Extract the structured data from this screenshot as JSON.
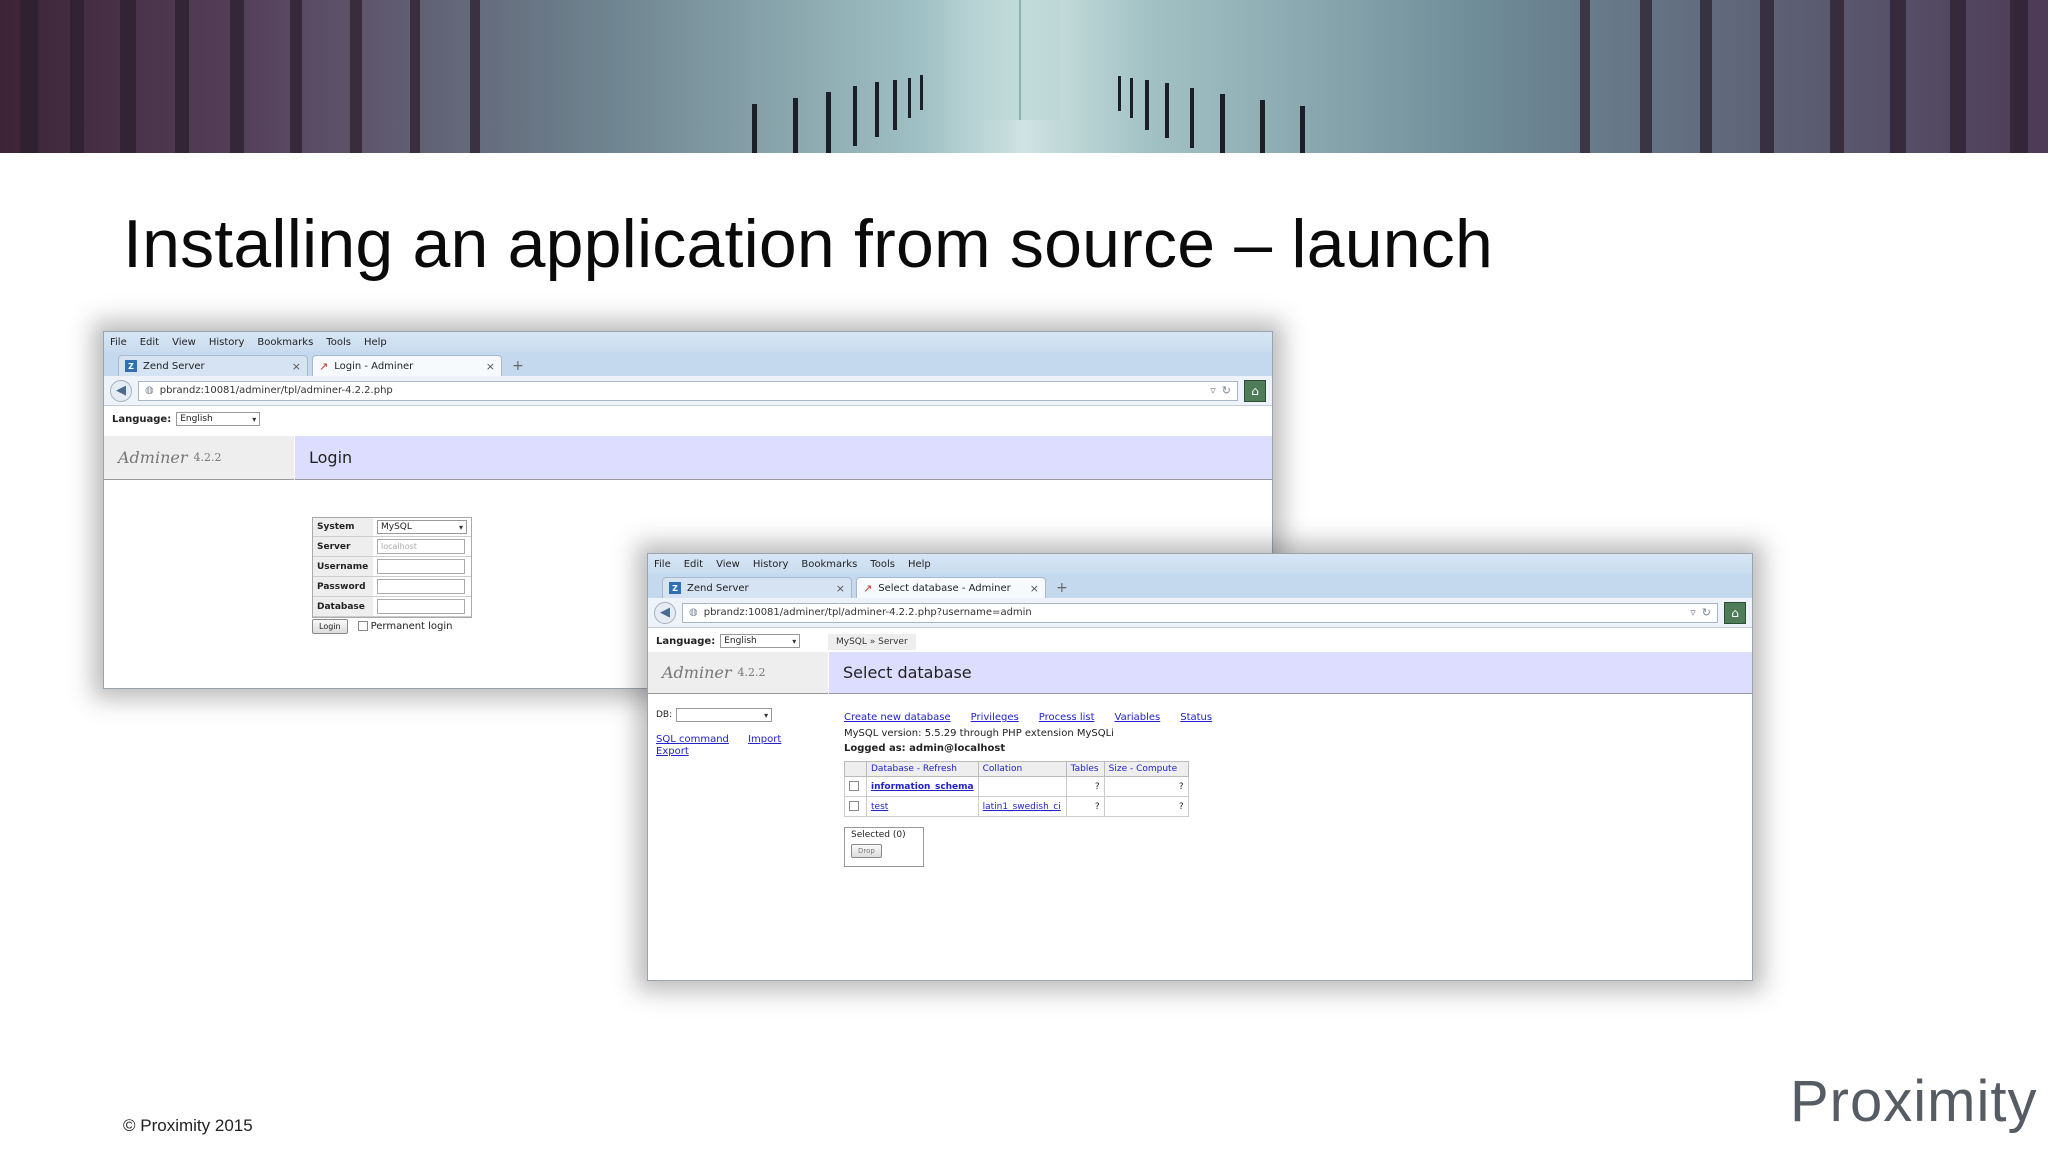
{
  "slide": {
    "title": "Installing an application from source – launch",
    "footer": "© Proximity 2015",
    "logo": "Proximity"
  },
  "browser1": {
    "menu": [
      "File",
      "Edit",
      "View",
      "History",
      "Bookmarks",
      "Tools",
      "Help"
    ],
    "tabs": [
      {
        "label": "Zend Server",
        "active": false
      },
      {
        "label": "Login - Adminer",
        "active": true
      }
    ],
    "url": "pbrandz:10081/adminer/tpl/adminer-4.2.2.php",
    "language_label": "Language:",
    "language_value": "English",
    "adminer_name": "Adminer",
    "adminer_version": "4.2.2",
    "page_heading": "Login",
    "form": {
      "fields": [
        {
          "label": "System",
          "value": "MySQL",
          "kind": "select"
        },
        {
          "label": "Server",
          "value": "localhost",
          "kind": "input"
        },
        {
          "label": "Username",
          "value": "",
          "kind": "input"
        },
        {
          "label": "Password",
          "value": "",
          "kind": "input"
        },
        {
          "label": "Database",
          "value": "",
          "kind": "input"
        }
      ],
      "login_button": "Login",
      "permanent_login": "Permanent login"
    }
  },
  "browser2": {
    "menu": [
      "File",
      "Edit",
      "View",
      "History",
      "Bookmarks",
      "Tools",
      "Help"
    ],
    "tabs": [
      {
        "label": "Zend Server",
        "active": false
      },
      {
        "label": "Select database - Adminer",
        "active": true
      }
    ],
    "url": "pbrandz:10081/adminer/tpl/adminer-4.2.2.php?username=admin",
    "language_label": "Language:",
    "language_value": "English",
    "breadcrumb": "MySQL » Server",
    "adminer_name": "Adminer",
    "adminer_version": "4.2.2",
    "page_heading": "Select database",
    "db_label": "DB:",
    "side_links": [
      "SQL command",
      "Import",
      "Export"
    ],
    "top_links": [
      "Create new database",
      "Privileges",
      "Process list",
      "Variables",
      "Status"
    ],
    "mysql_version": "MySQL version: 5.5.29 through PHP extension MySQLi",
    "logged_as": "Logged as: admin@localhost",
    "table": {
      "headers": [
        "Database - Refresh",
        "Collation",
        "Tables",
        "Size - Compute"
      ],
      "rows": [
        {
          "name": "information_schema",
          "collation": "",
          "tables": "?",
          "size": "?"
        },
        {
          "name": "test",
          "collation": "latin1_swedish_ci",
          "tables": "?",
          "size": "?"
        }
      ]
    },
    "selected_label": "Selected (0)",
    "drop_button": "Drop"
  }
}
